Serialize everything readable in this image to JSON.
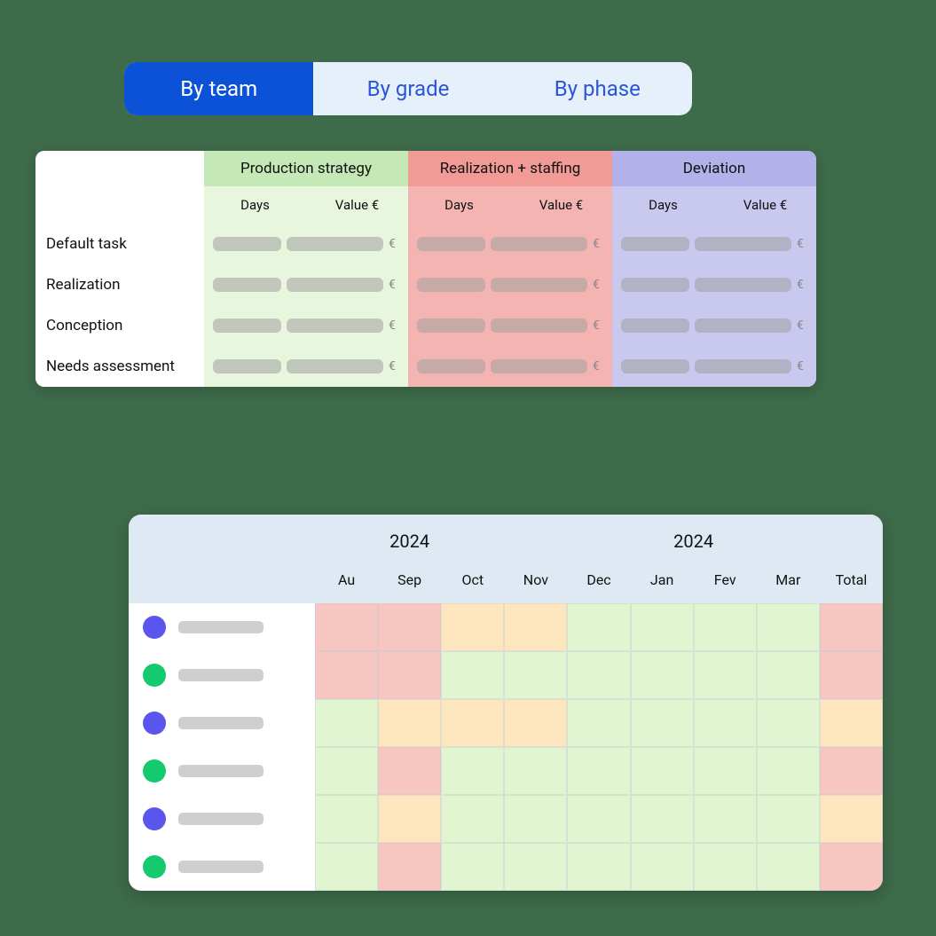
{
  "tabs": {
    "by_team": "By team",
    "by_grade": "By grade",
    "by_phase": "By phase",
    "active": "by_team"
  },
  "upper": {
    "columns": {
      "production": {
        "title": "Production strategy",
        "sub_days": "Days",
        "sub_value": "Value €"
      },
      "realization": {
        "title": "Realization + staffing",
        "sub_days": "Days",
        "sub_value": "Value €"
      },
      "deviation": {
        "title": "Deviation",
        "sub_days": "Days",
        "sub_value": "Value €"
      }
    },
    "rows": [
      "Default task",
      "Realization",
      "Conception",
      "Needs assessment"
    ],
    "euro": "€"
  },
  "lower": {
    "year_left": "2024",
    "year_right": "2024",
    "months": [
      "Au",
      "Sep",
      "Oct",
      "Nov",
      "Dec",
      "Jan",
      "Fev",
      "Mar",
      "Total"
    ],
    "rows": [
      {
        "color": "purple",
        "cells": [
          "r",
          "r",
          "o",
          "o",
          "g",
          "g",
          "g",
          "g",
          "r"
        ]
      },
      {
        "color": "green",
        "cells": [
          "r",
          "r",
          "g",
          "g",
          "g",
          "g",
          "g",
          "g",
          "r"
        ]
      },
      {
        "color": "purple",
        "cells": [
          "g",
          "o",
          "o",
          "o",
          "g",
          "g",
          "g",
          "g",
          "o"
        ]
      },
      {
        "color": "green",
        "cells": [
          "g",
          "r",
          "g",
          "g",
          "g",
          "g",
          "g",
          "g",
          "r"
        ]
      },
      {
        "color": "purple",
        "cells": [
          "g",
          "o",
          "g",
          "g",
          "g",
          "g",
          "g",
          "g",
          "o"
        ]
      },
      {
        "color": "green",
        "cells": [
          "g",
          "r",
          "g",
          "g",
          "g",
          "g",
          "g",
          "g",
          "r"
        ]
      }
    ]
  }
}
